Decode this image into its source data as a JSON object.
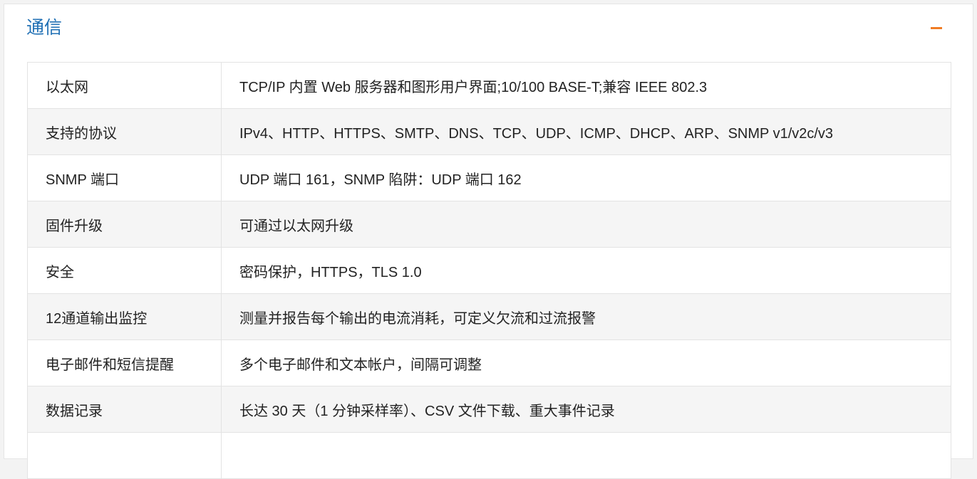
{
  "section": {
    "title": "通信",
    "collapse_icon": "minus-icon",
    "accent_color": "#f07c24",
    "title_color": "#1f6fb4"
  },
  "rows": [
    {
      "label": "以太网",
      "value": "TCP/IP 内置 Web 服务器和图形用户界面;10/100 BASE-T;兼容 IEEE 802.3"
    },
    {
      "label": "支持的协议",
      "value": "IPv4、HTTP、HTTPS、SMTP、DNS、TCP、UDP、ICMP、DHCP、ARP、SNMP v1/v2c/v3"
    },
    {
      "label": "SNMP 端口",
      "value": "UDP 端口 161，SNMP 陷阱：UDP 端口 162"
    },
    {
      "label": "固件升级",
      "value": "可通过以太网升级"
    },
    {
      "label": "安全",
      "value": "密码保护，HTTPS，TLS 1.0"
    },
    {
      "label": "12通道输出监控",
      "value": "测量并报告每个输出的电流消耗，可定义欠流和过流报警"
    },
    {
      "label": "电子邮件和短信提醒",
      "value": "多个电子邮件和文本帐户，间隔可调整"
    },
    {
      "label": "数据记录",
      "value": "长达 30 天（1 分钟采样率）、CSV 文件下载、重大事件记录"
    }
  ]
}
